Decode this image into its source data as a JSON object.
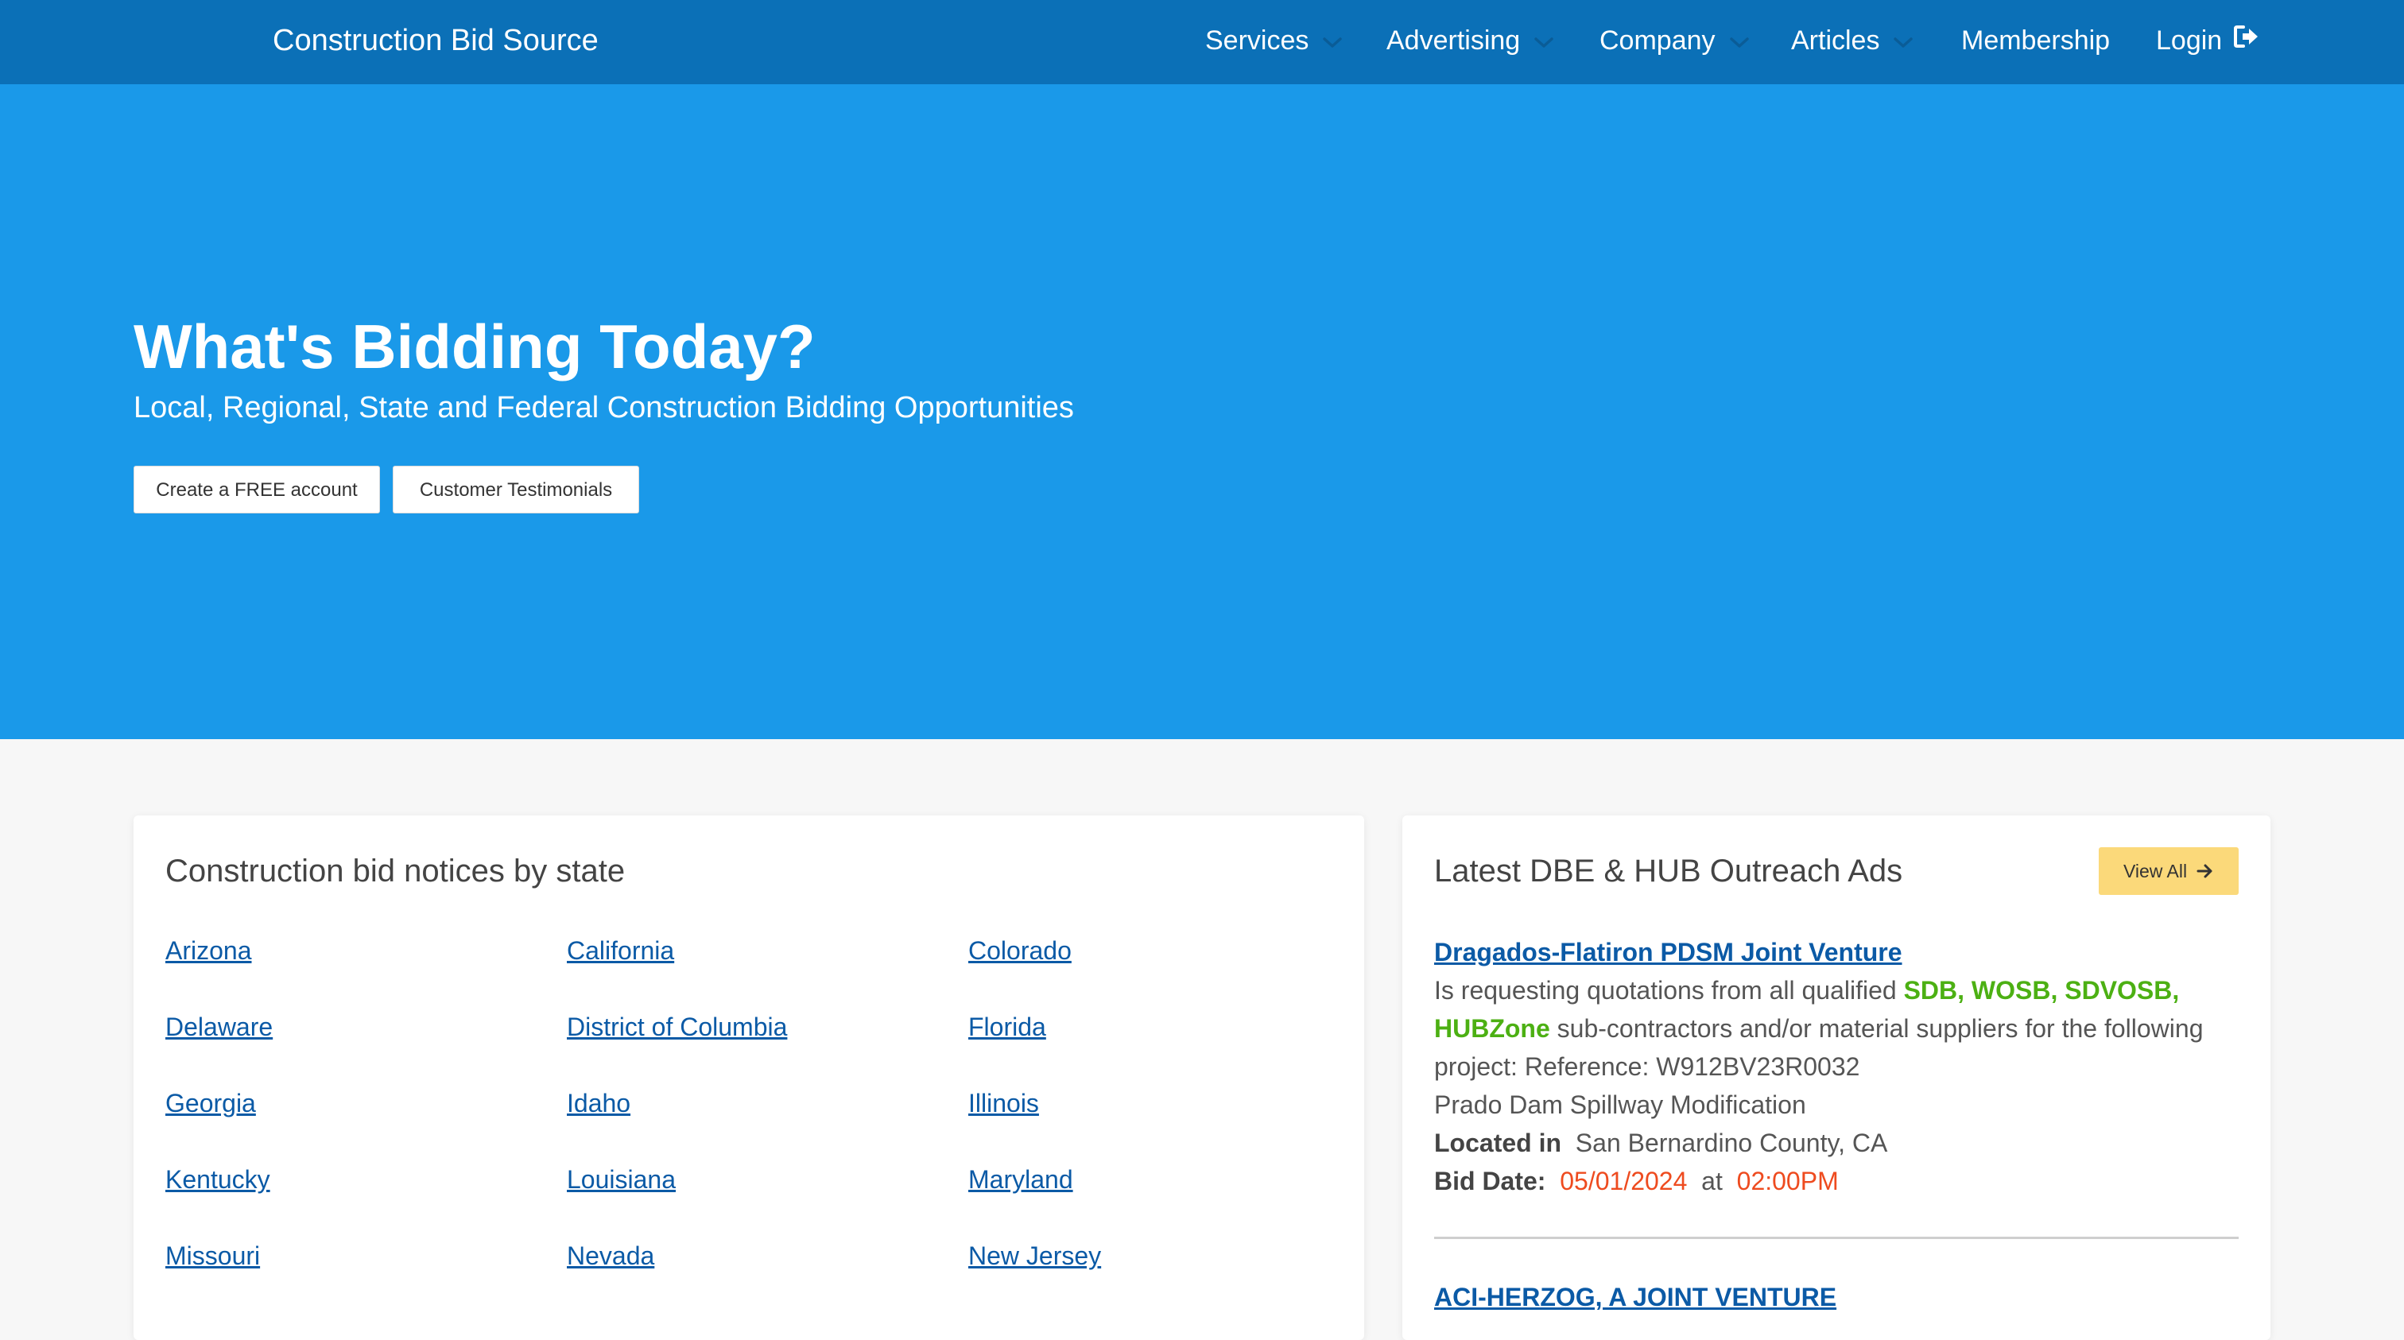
{
  "nav": {
    "brand": "Construction Bid Source",
    "items": [
      {
        "label": "Services"
      },
      {
        "label": "Advertising"
      },
      {
        "label": "Company"
      },
      {
        "label": "Articles"
      },
      {
        "label": "Membership"
      },
      {
        "label": "Login"
      }
    ]
  },
  "hero": {
    "title": "What's Bidding Today?",
    "subtitle": "Local, Regional, State and Federal Construction Bidding Opportunities",
    "buttons": [
      "Create a FREE account",
      "Customer Testimonials"
    ]
  },
  "states_card": {
    "title": "Construction bid notices by state",
    "states": [
      "Arizona",
      "California",
      "Colorado",
      "Delaware",
      "District of Columbia",
      "Florida",
      "Georgia",
      "Idaho",
      "Illinois",
      "Kentucky",
      "Louisiana",
      "Maryland",
      "Missouri",
      "Nevada",
      "New Jersey"
    ]
  },
  "ads_card": {
    "title": "Latest DBE & HUB Outreach Ads",
    "view_all": "View All",
    "ad1": {
      "company": "Dragados-Flatiron PDSM Joint Venture",
      "intro": "Is requesting quotations from all qualified ",
      "certs": "SDB, WOSB, SDVOSB, HUBZone",
      "body": " sub-contractors and/or material suppliers for the following project: Reference: W912BV23R0032",
      "project": "Prado Dam Spillway Modification",
      "located_label": "Located in",
      "location": "San Bernardino County, CA",
      "bid_label": "Bid Date:",
      "bid_date": "05/01/2024",
      "at": "at",
      "bid_time": "02:00PM"
    },
    "ad2": {
      "company": "ACI-HERZOG, A JOINT VENTURE"
    }
  },
  "colors": {
    "nav_bg": "#0b70b7",
    "hero_bg": "#1a99e9",
    "link": "#0b5aa6",
    "cert_green": "#4cb013",
    "date_red": "#ee4b1f",
    "view_all_bg": "#fbd97a"
  },
  "icons": [
    "chevron-down-icon",
    "sign-out-icon",
    "arrow-right-icon"
  ]
}
